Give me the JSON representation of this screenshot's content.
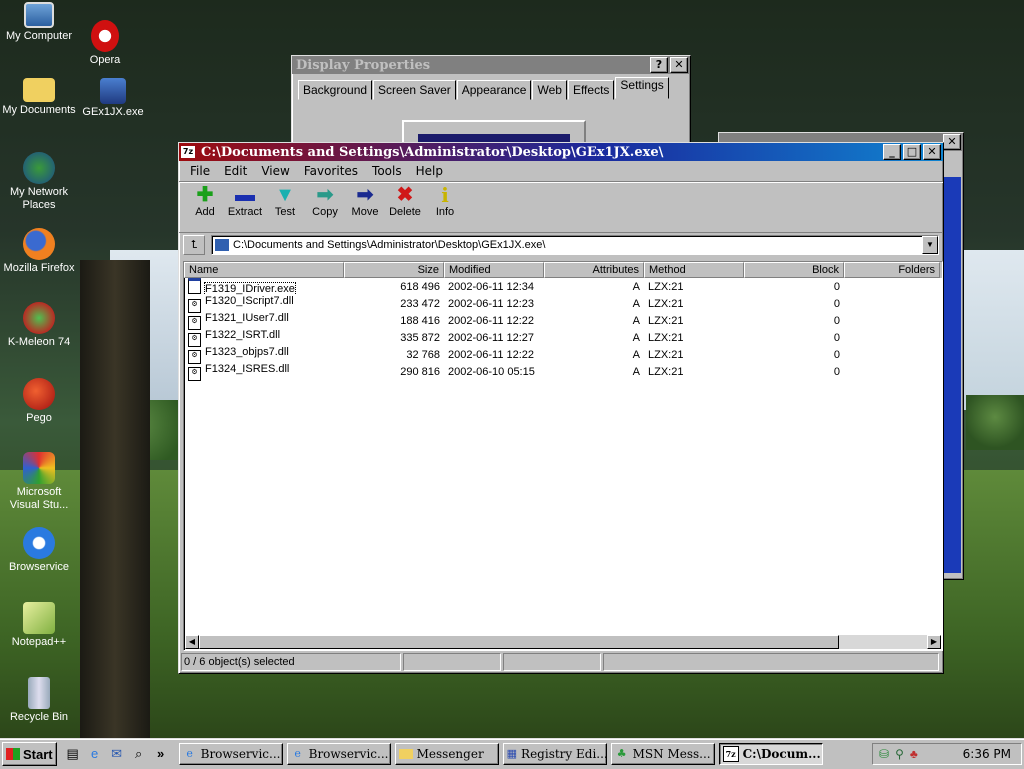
{
  "desktop": {
    "icons": [
      {
        "label": "My Computer",
        "icon": "computer-icon"
      },
      {
        "label": "Opera",
        "icon": "opera-icon"
      },
      {
        "label": "My Documents",
        "icon": "folder-icon"
      },
      {
        "label": "GEx1JX.exe",
        "icon": "exe-icon"
      },
      {
        "label": "My Network Places",
        "icon": "network-icon"
      },
      {
        "label": "Mozilla Firefox",
        "icon": "firefox-icon"
      },
      {
        "label": "K-Meleon 74",
        "icon": "kmeleon-icon"
      },
      {
        "label": "Pego",
        "icon": "pego-icon"
      },
      {
        "label": "Microsoft Visual Stu...",
        "icon": "visual-studio-icon"
      },
      {
        "label": "Browservice",
        "icon": "ie-icon"
      },
      {
        "label": "Notepad++",
        "icon": "notepad-icon"
      },
      {
        "label": "Recycle Bin",
        "icon": "recycle-bin-icon"
      }
    ]
  },
  "display_properties": {
    "title": "Display Properties",
    "help": "?",
    "close": "✕",
    "tabs": [
      "Background",
      "Screen Saver",
      "Appearance",
      "Web",
      "Effects",
      "Settings"
    ],
    "active_tab": "Settings"
  },
  "archiver": {
    "title": "C:\\Documents and Settings\\Administrator\\Desktop\\GEx1JX.exe\\",
    "app_icon": "7z",
    "menu": [
      "File",
      "Edit",
      "View",
      "Favorites",
      "Tools",
      "Help"
    ],
    "toolbar": [
      {
        "label": "Add",
        "glyph": "✚",
        "color": "#1aa01a"
      },
      {
        "label": "Extract",
        "glyph": "▬",
        "color": "#1a2fb0"
      },
      {
        "label": "Test",
        "glyph": "▼",
        "color": "#1ab0b0"
      },
      {
        "label": "Copy",
        "glyph": "➡",
        "color": "#2a9a8a"
      },
      {
        "label": "Move",
        "glyph": "➡",
        "color": "#1a2a90"
      },
      {
        "label": "Delete",
        "glyph": "✖",
        "color": "#d01818"
      },
      {
        "label": "Info",
        "glyph": "i",
        "color": "#c8b400"
      }
    ],
    "address": "C:\\Documents and Settings\\Administrator\\Desktop\\GEx1JX.exe\\",
    "columns": [
      "Name",
      "Size",
      "Modified",
      "Attributes",
      "Method",
      "Block",
      "Folders"
    ],
    "files": [
      {
        "name": "F1319_IDriver.exe",
        "size": "618 496",
        "modified": "2002-06-11 12:34",
        "attributes": "A",
        "method": "LZX:21",
        "block": "0"
      },
      {
        "name": "F1320_IScript7.dll",
        "size": "233 472",
        "modified": "2002-06-11 12:23",
        "attributes": "A",
        "method": "LZX:21",
        "block": "0"
      },
      {
        "name": "F1321_IUser7.dll",
        "size": "188 416",
        "modified": "2002-06-11 12:22",
        "attributes": "A",
        "method": "LZX:21",
        "block": "0"
      },
      {
        "name": "F1322_ISRT.dll",
        "size": "335 872",
        "modified": "2002-06-11 12:27",
        "attributes": "A",
        "method": "LZX:21",
        "block": "0"
      },
      {
        "name": "F1323_objps7.dll",
        "size": "32 768",
        "modified": "2002-06-11 12:22",
        "attributes": "A",
        "method": "LZX:21",
        "block": "0"
      },
      {
        "name": "F1324_ISRES.dll",
        "size": "290 816",
        "modified": "2002-06-10 05:15",
        "attributes": "A",
        "method": "LZX:21",
        "block": "0"
      }
    ],
    "status": "0 / 6 object(s) selected"
  },
  "taskbar": {
    "start": "Start",
    "tasks": [
      {
        "label": "Browservic...",
        "icon": "ie-icon"
      },
      {
        "label": "Browservic...",
        "icon": "ie-icon"
      },
      {
        "label": "Messenger",
        "icon": "folder-icon"
      },
      {
        "label": "Registry Edi...",
        "icon": "registry-icon"
      },
      {
        "label": "MSN Mess...",
        "icon": "msn-icon"
      },
      {
        "label": "C:\\Docum...",
        "icon": "7z-icon"
      }
    ],
    "clock": "6:36 PM"
  }
}
